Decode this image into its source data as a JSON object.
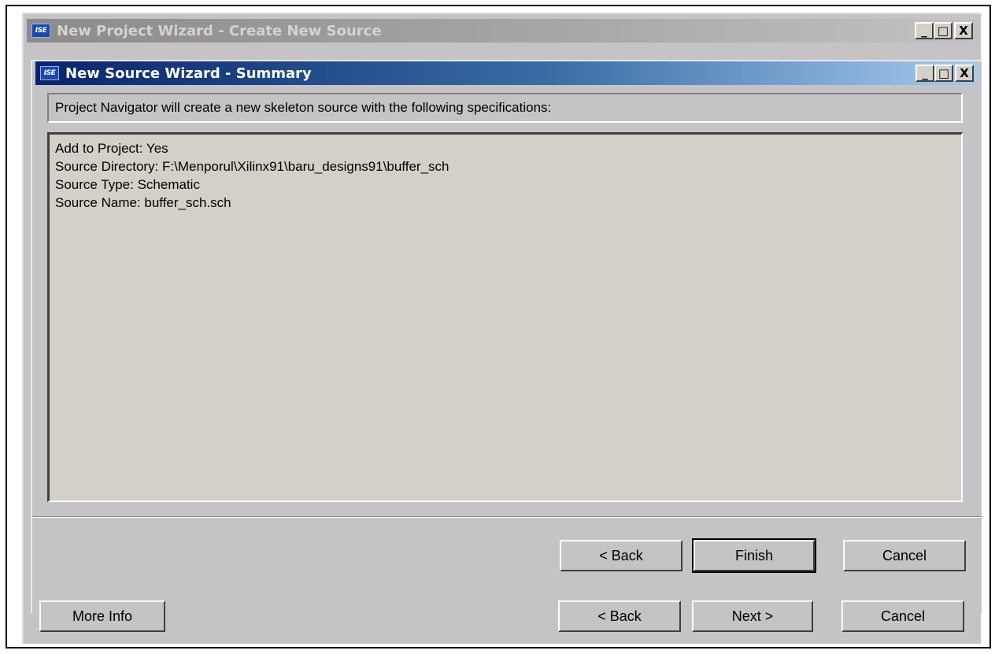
{
  "outer_window": {
    "title": "New Project Wizard - Create New Source",
    "controls": {
      "minimize": "_",
      "maximize": "□",
      "close": "X"
    },
    "buttons": {
      "more_info": "More Info",
      "back": "< Back",
      "next": "Next >",
      "cancel": "Cancel"
    }
  },
  "inner_window": {
    "title": "New Source Wizard - Summary",
    "controls": {
      "minimize": "_",
      "maximize": "□",
      "close": "X"
    },
    "header_text": "Project Navigator will create a new skeleton source with the following specifications:",
    "summary_lines": [
      "Add to Project: Yes",
      "Source Directory: F:\\Menporul\\Xilinx91\\baru_designs91\\buffer_sch",
      "Source Type: Schematic",
      "Source Name: buffer_sch.sch"
    ],
    "buttons": {
      "back": "< Back",
      "finish": "Finish",
      "cancel": "Cancel"
    }
  },
  "app_icon_label": "ISE",
  "colors": {
    "active_title_start": "#08246b",
    "active_title_end": "#a6caf0",
    "inactive_title": "#8b8b8b",
    "dialog_face": "#c6c3c6"
  }
}
